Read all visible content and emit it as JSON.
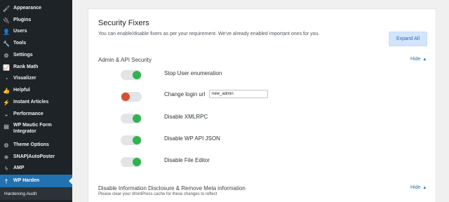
{
  "sidebar": {
    "items": [
      {
        "label": "Appearance",
        "icon": "paintbrush-icon",
        "glyph": "🖌"
      },
      {
        "label": "Plugins",
        "icon": "plug-icon",
        "glyph": "🔌"
      },
      {
        "label": "Users",
        "icon": "user-icon",
        "glyph": "👤"
      },
      {
        "label": "Tools",
        "icon": "wrench-icon",
        "glyph": "🔧"
      },
      {
        "label": "Settings",
        "icon": "settings-icon",
        "glyph": "⚙"
      },
      {
        "label": "Rank Math",
        "icon": "chart-icon",
        "glyph": "📈"
      },
      {
        "label": "Visualizer",
        "icon": "pie-chart-icon",
        "glyph": "◔"
      },
      {
        "label": "Helpful",
        "icon": "thumbs-up-icon",
        "glyph": "👍"
      },
      {
        "label": "Instant Articles",
        "icon": "bolt-icon",
        "glyph": "⚡"
      },
      {
        "label": "Performance",
        "icon": "gauge-icon",
        "glyph": "◒"
      },
      {
        "label": "WP Mautic Form Integrator",
        "icon": "form-icon",
        "glyph": "▤"
      },
      {
        "label": "Theme Options",
        "icon": "gear-icon",
        "glyph": "⚙"
      },
      {
        "label": "SNAP|AutoPoster",
        "icon": "share-icon",
        "glyph": "✳"
      },
      {
        "label": "AMP",
        "icon": "amp-icon",
        "glyph": "ϟ"
      },
      {
        "label": "WP Harden",
        "icon": "pin-icon",
        "glyph": "†",
        "active": true
      }
    ],
    "submenu": {
      "label": "Hardening Audit"
    }
  },
  "main": {
    "title": "Security Fixers",
    "subtitle": "You can enable/disable fixers as per your requirement. We've already enabled important ones for you.",
    "expand_button": "Expand All",
    "sections": [
      {
        "title": "Admin & API Security",
        "hide_label": "Hide"
      },
      {
        "title": "Disable Information Disclosure & Remove Meta information",
        "hide_label": "Hide",
        "note": "Please clear your WordPress cache for these changes to reflect"
      }
    ],
    "fixers": [
      {
        "label": "Stop User enumeration",
        "enabled": true
      },
      {
        "label": "Change login url",
        "enabled": false,
        "input_value": "new_admin"
      },
      {
        "label": "Disable XMLRPC",
        "enabled": true
      },
      {
        "label": "Disable WP API JSON",
        "enabled": true
      },
      {
        "label": "Disable File Editor",
        "enabled": true
      }
    ]
  },
  "colors": {
    "sidebar_bg": "#1d2327",
    "active_bg": "#2271b1",
    "toggle_on": "#2eb34d",
    "toggle_off": "#d84f2f",
    "link": "#2271b1"
  }
}
